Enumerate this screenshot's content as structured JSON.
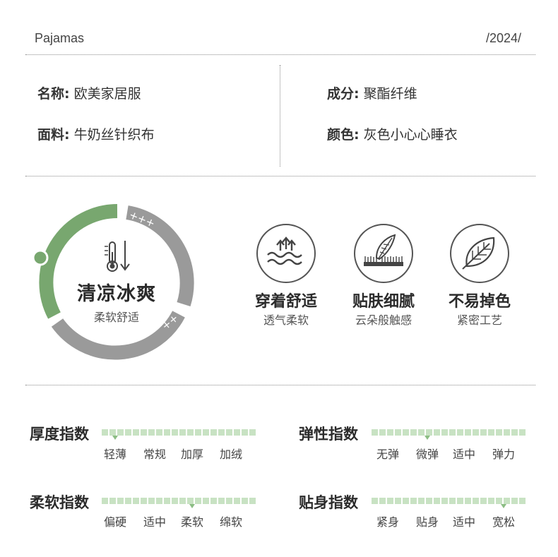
{
  "header": {
    "title": "Pajamas",
    "year": "/2024/"
  },
  "specs": [
    {
      "key": "名称:",
      "value": "欧美家居服"
    },
    {
      "key": "成分:",
      "value": "聚酯纤维"
    },
    {
      "key": "面料:",
      "value": "牛奶丝针织布"
    },
    {
      "key": "颜色:",
      "value": "灰色小心心睡衣"
    }
  ],
  "gauge": {
    "title": "清凉冰爽",
    "subtitle": "柔软舒适",
    "plus_top": "+++",
    "plus_bottom": "++",
    "colors": {
      "green": "#78a76f",
      "gray": "#9a9a9a"
    }
  },
  "features": [
    {
      "icon": "breathable-wave-icon",
      "title": "穿着舒适",
      "subtitle": "透气柔软"
    },
    {
      "icon": "feather-skin-icon",
      "title": "贴肤细腻",
      "subtitle": "云朵般触感"
    },
    {
      "icon": "leaf-icon",
      "title": "不易掉色",
      "subtitle": "紧密工艺"
    }
  ],
  "indices": [
    {
      "title": "厚度指数",
      "options": [
        "轻薄",
        "常规",
        "加厚",
        "加绒"
      ],
      "selected": 0
    },
    {
      "title": "弹性指数",
      "options": [
        "无弹",
        "微弹",
        "适中",
        "弹力"
      ],
      "selected": 1
    },
    {
      "title": "柔软指数",
      "options": [
        "偏硬",
        "适中",
        "柔软",
        "绵软"
      ],
      "selected": 2
    },
    {
      "title": "贴身指数",
      "options": [
        "紧身",
        "贴身",
        "适中",
        "宽松"
      ],
      "selected": 3
    }
  ]
}
